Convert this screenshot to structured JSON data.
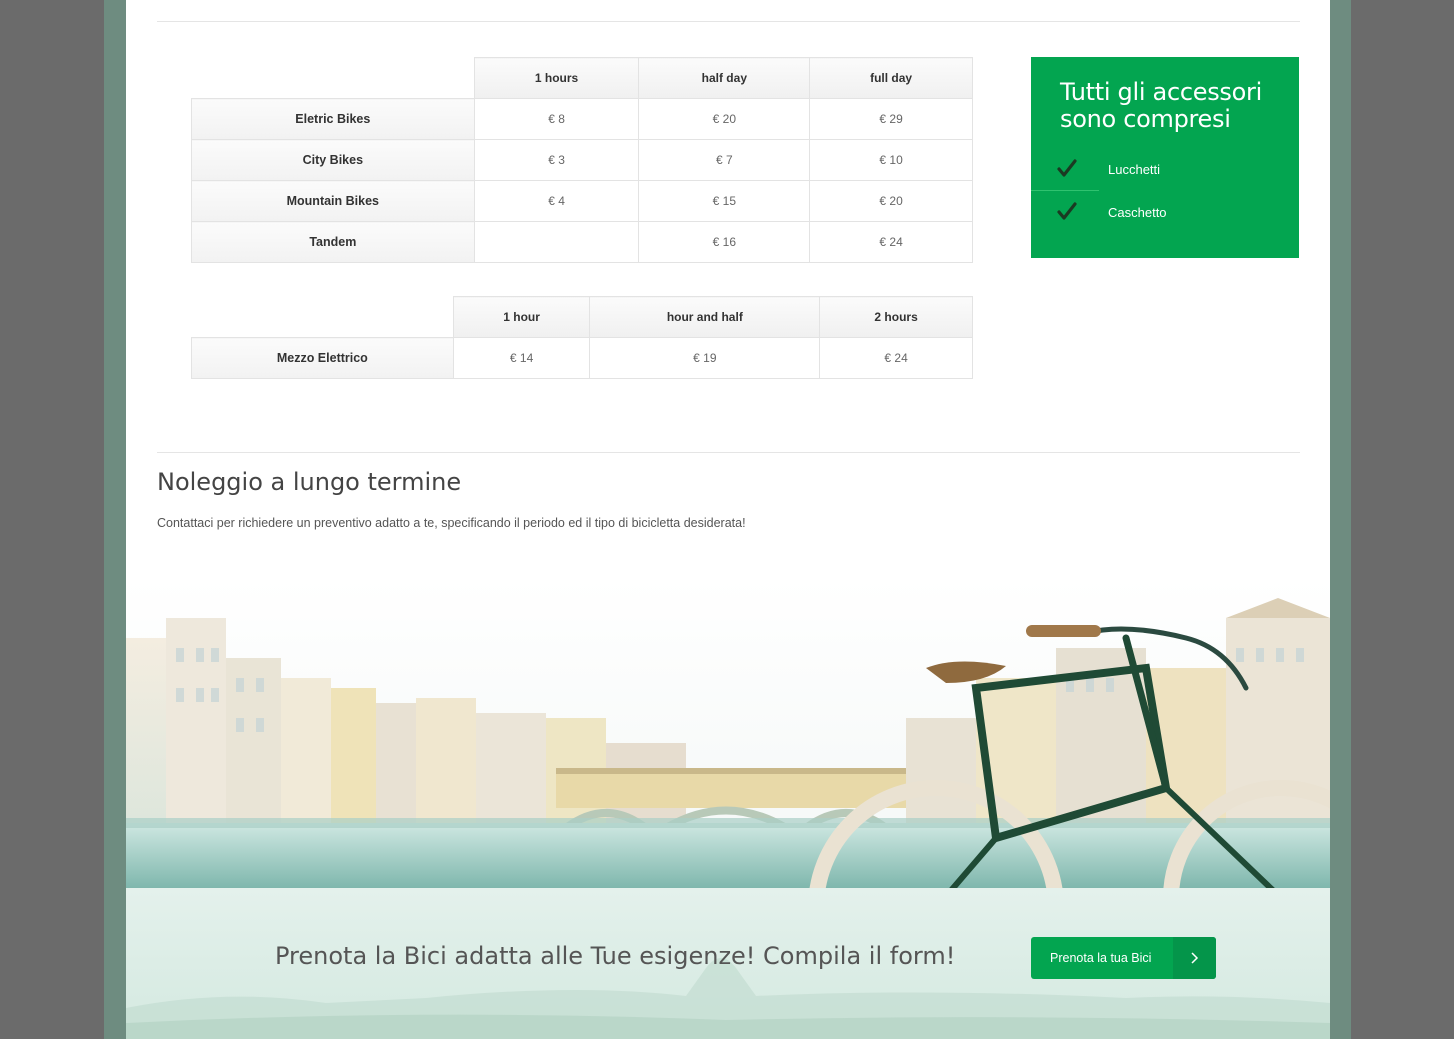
{
  "pricing_table": {
    "headers": [
      "1 hours",
      "half day",
      "full day"
    ],
    "rows": [
      {
        "name": "Eletric Bikes",
        "values": [
          "€ 8",
          "€ 20",
          "€ 29"
        ]
      },
      {
        "name": "City Bikes",
        "values": [
          "€ 3",
          "€ 7",
          "€ 10"
        ]
      },
      {
        "name": "Mountain Bikes",
        "values": [
          "€ 4",
          "€ 15",
          "€ 20"
        ]
      },
      {
        "name": "Tandem",
        "values": [
          "",
          "€ 16",
          "€ 24"
        ]
      }
    ]
  },
  "electric_table": {
    "headers": [
      "1 hour",
      "hour and half",
      "2 hours"
    ],
    "rows": [
      {
        "name": "Mezzo Elettrico",
        "values": [
          "€ 14",
          "€ 19",
          "€ 24"
        ]
      }
    ]
  },
  "accessories": {
    "title": "Tutti gli accessori sono compresi",
    "items": [
      "Lucchetti",
      "Caschetto"
    ],
    "check_icon": "checkmark-icon"
  },
  "long_term": {
    "title": "Noleggio a lungo termine",
    "text": "Contattaci per richiedere un preventivo adatto a te, specificando il periodo ed il tipo di bicicletta desiderata!"
  },
  "cta": {
    "message": "Prenota la Bici adatta alle Tue esigenze! Compila il form!",
    "button_label": "Prenota la tua Bici",
    "button_icon": "chevron-right-icon"
  },
  "colors": {
    "accent": "#03a550",
    "frame": "#6e8c80"
  }
}
